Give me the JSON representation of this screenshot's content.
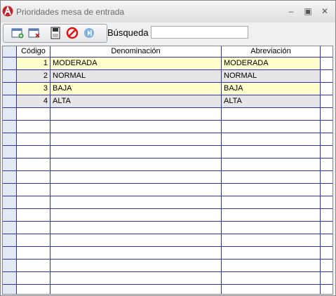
{
  "window": {
    "title": "Prioridades mesa de entrada"
  },
  "toolbar": {
    "buttons": [
      "calendar-add-icon",
      "calendar-delete-icon",
      "save-icon",
      "cancel-icon",
      "next-icon"
    ]
  },
  "search": {
    "label": "Búsqueda",
    "value": ""
  },
  "table": {
    "columns": [
      "Código",
      "Denominación",
      "Abreviación"
    ],
    "rows": [
      {
        "codigo": "1",
        "denominacion": "MODERADA",
        "abreviacion": "MODERADA"
      },
      {
        "codigo": "2",
        "denominacion": "NORMAL",
        "abreviacion": "NORMAL"
      },
      {
        "codigo": "3",
        "denominacion": "BAJA",
        "abreviacion": "BAJA"
      },
      {
        "codigo": "4",
        "denominacion": "ALTA",
        "abreviacion": "ALTA"
      }
    ]
  },
  "colors": {
    "row_highlight": "#ffffcc",
    "row_alt": "#e6e6e6",
    "grid_line": "#2f2fc0"
  }
}
